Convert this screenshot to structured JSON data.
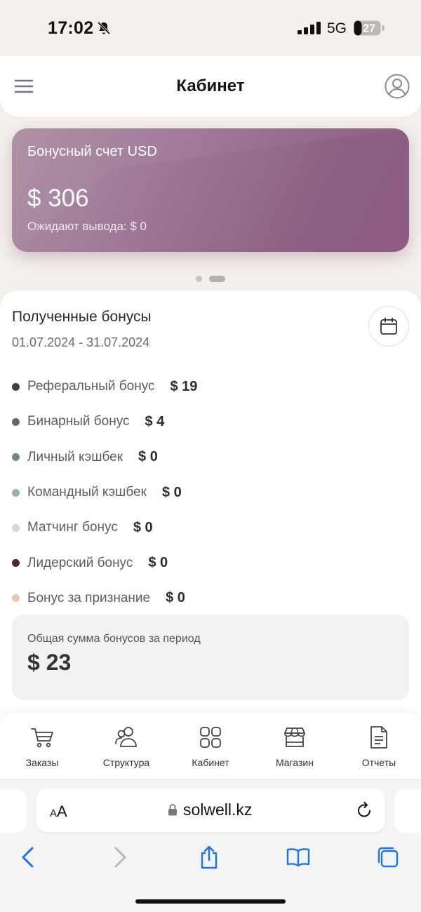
{
  "status_bar": {
    "time": "17:02",
    "network": "5G",
    "battery": "27"
  },
  "header": {
    "title": "Кабинет",
    "menu_icon": "hamburger-menu-icon",
    "profile_icon": "user-circle-icon"
  },
  "bonus_card": {
    "title": "Бонусный счет USD",
    "amount": "$ 306",
    "pending": "Ожидают вывода: $ 0",
    "gradient_colors": [
      "#a98aa0",
      "#8a5480"
    ]
  },
  "pager": {
    "pages": 2,
    "active_index": 1
  },
  "bonuses": {
    "title": "Полученные бонусы",
    "period": "01.07.2024 - 31.07.2024",
    "calendar_icon": "calendar-icon",
    "items": [
      {
        "label": "Реферальный бонус",
        "value": "$ 19",
        "color": "#3f3f3f"
      },
      {
        "label": "Бинарный бонус",
        "value": "$ 4",
        "color": "#5f6e60"
      },
      {
        "label": "Личный кэшбек",
        "value": "$ 0",
        "color": "#6f8c74"
      },
      {
        "label": "Командный кэшбек",
        "value": "$ 0",
        "color": "#97b59d"
      },
      {
        "label": "Матчинг бонус",
        "value": "$ 0",
        "color": "#c8ddcf"
      },
      {
        "label": "Лидерский бонус",
        "value": "$ 0",
        "color": "#4a2c28"
      },
      {
        "label": "Бонус за признание",
        "value": "$ 0",
        "color": "#e8c9ae"
      }
    ],
    "total_label": "Общая сумма бонусов за период",
    "total_value": "$ 23"
  },
  "tabbar": {
    "tabs": [
      {
        "label": "Заказы",
        "icon": "cart-icon"
      },
      {
        "label": "Структура",
        "icon": "users-icon"
      },
      {
        "label": "Кабинет",
        "icon": "grid-icon"
      },
      {
        "label": "Магазин",
        "icon": "store-icon"
      },
      {
        "label": "Отчеты",
        "icon": "document-icon"
      }
    ]
  },
  "browser": {
    "text_size_label_small": "A",
    "text_size_label_large": "A",
    "url": "solwell.kz",
    "accent_color": "#1a73e8"
  }
}
